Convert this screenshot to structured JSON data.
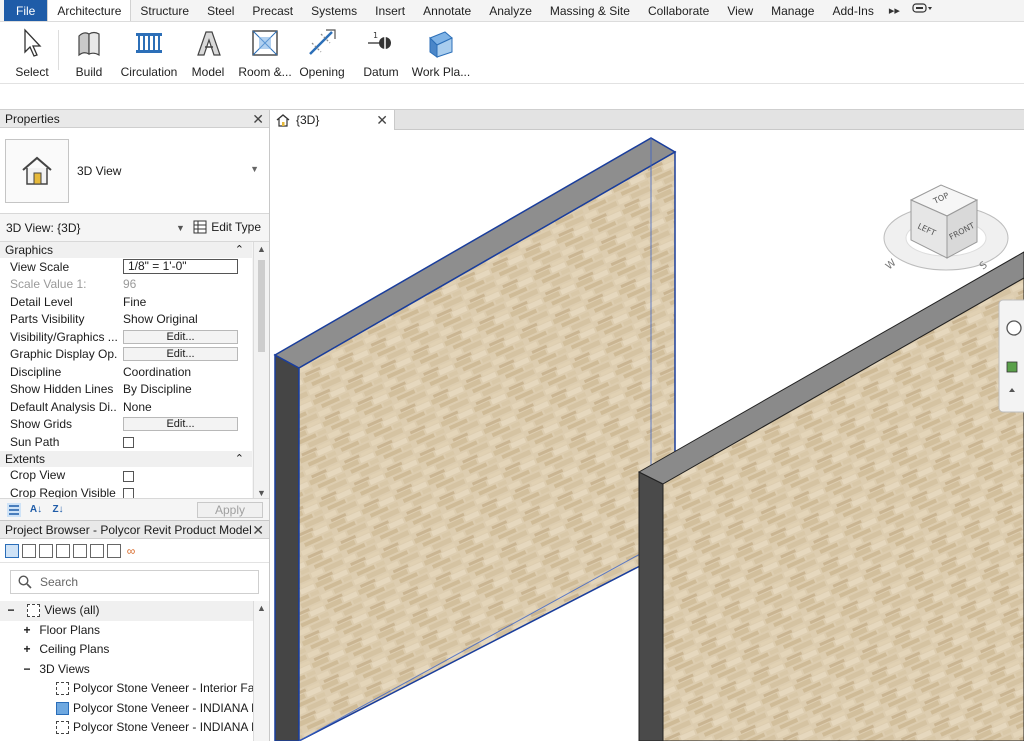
{
  "menu": {
    "items": [
      "File",
      "Architecture",
      "Structure",
      "Steel",
      "Precast",
      "Systems",
      "Insert",
      "Annotate",
      "Analyze",
      "Massing & Site",
      "Collaborate",
      "View",
      "Manage",
      "Add-Ins"
    ],
    "active": "Architecture"
  },
  "ribbon": {
    "buttons": [
      {
        "label": "Select",
        "icon": "cursor-arrow-icon"
      },
      {
        "label": "Build",
        "icon": "wall-icon"
      },
      {
        "label": "Circulation",
        "icon": "railing-icon"
      },
      {
        "label": "Model",
        "icon": "model-text-icon"
      },
      {
        "label": "Room &...",
        "icon": "room-icon"
      },
      {
        "label": "Opening",
        "icon": "opening-icon"
      },
      {
        "label": "Datum",
        "icon": "datum-icon"
      },
      {
        "label": "Work Pla...",
        "icon": "work-plane-icon"
      }
    ]
  },
  "properties": {
    "title": "Properties",
    "type_name": "3D View",
    "instance_label": "3D View: {3D}",
    "edit_type_label": "Edit Type",
    "groups": {
      "graphics": "Graphics",
      "extents": "Extents"
    },
    "rows": {
      "view_scale": {
        "name": "View Scale",
        "value": "1/8\" = 1'-0\""
      },
      "scale_value": {
        "name": "Scale Value    1:",
        "value": "96"
      },
      "detail_level": {
        "name": "Detail Level",
        "value": "Fine"
      },
      "parts_visibility": {
        "name": "Parts Visibility",
        "value": "Show Original"
      },
      "visibility_graphics": {
        "name": "Visibility/Graphics ...",
        "value": "Edit..."
      },
      "graphic_display": {
        "name": "Graphic Display Op...",
        "value": "Edit..."
      },
      "discipline": {
        "name": "Discipline",
        "value": "Coordination"
      },
      "show_hidden_lines": {
        "name": "Show Hidden Lines",
        "value": "By Discipline"
      },
      "default_analysis": {
        "name": "Default Analysis Di...",
        "value": "None"
      },
      "show_grids": {
        "name": "Show Grids",
        "value": "Edit..."
      },
      "sun_path": {
        "name": "Sun Path",
        "value": ""
      },
      "crop_view": {
        "name": "Crop View",
        "value": ""
      },
      "crop_region_visible": {
        "name": "Crop Region Visible",
        "value": ""
      }
    },
    "apply_label": "Apply"
  },
  "browser": {
    "title": "Project Browser - Polycor Revit Product Model...",
    "search_placeholder": "Search",
    "tree": {
      "root": "Views (all)",
      "floor_plans": "Floor Plans",
      "ceiling_plans": "Ceiling Plans",
      "views_3d": "3D Views",
      "view_1": "Polycor Stone Veneer - Interior Fac",
      "view_2": "Polycor Stone Veneer - INDIANA L",
      "view_3": "Polycor Stone Veneer - INDIANA L"
    }
  },
  "view_tab": {
    "title": "{3D}"
  },
  "viewcube": {
    "top": "TOP",
    "left": "LEFT",
    "front": "FRONT",
    "compass_w": "W",
    "compass_s": "S"
  },
  "colors": {
    "file_tab": "#1f5ca8",
    "selection_outline": "#1a3e9c",
    "wall_face": "#ddcdb0",
    "wall_edge": "#555555"
  }
}
